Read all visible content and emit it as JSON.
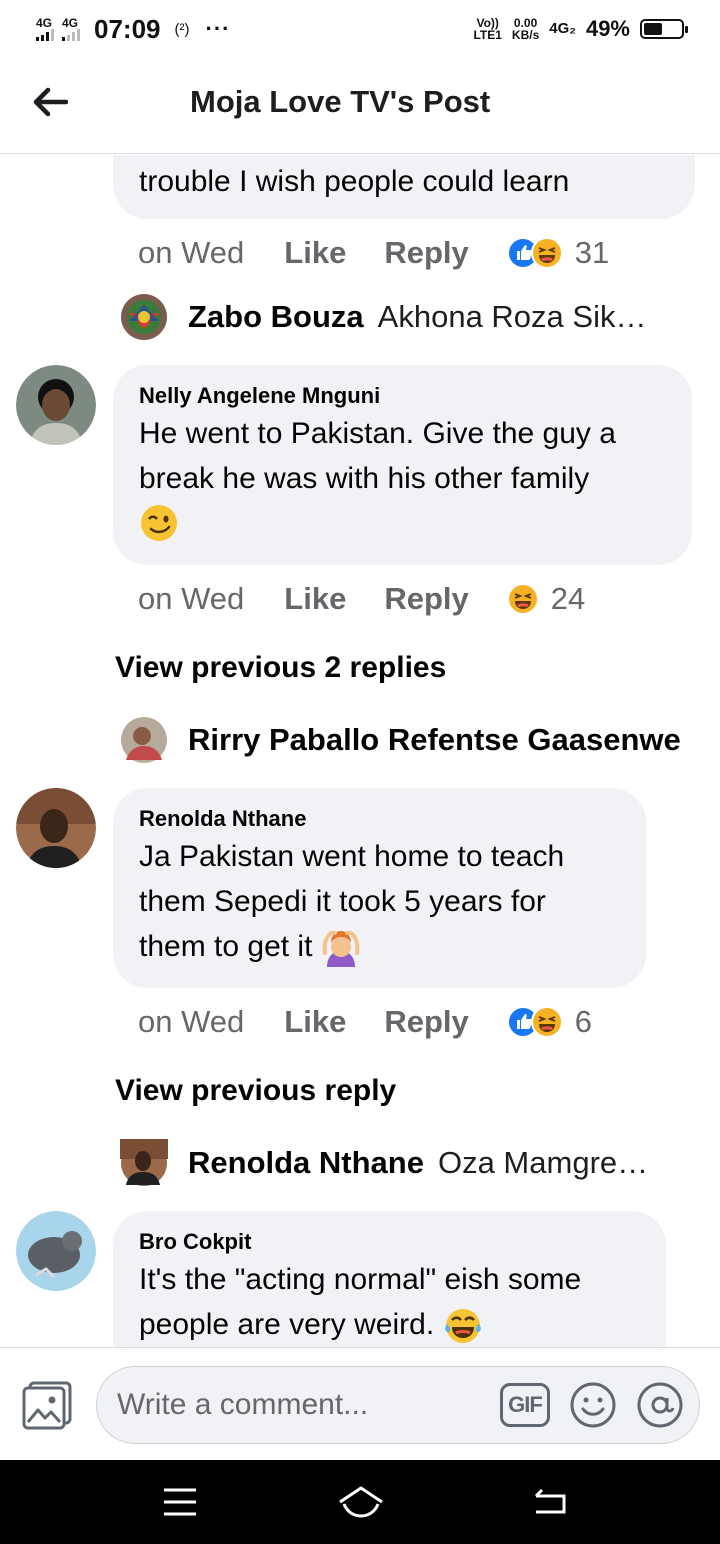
{
  "status_bar": {
    "network1": "4G",
    "network2": "4G",
    "time": "07:09",
    "hotspot": "(²)",
    "more": "···",
    "volte_top": "Vo))",
    "volte_bottom": "LTE1",
    "speed_top": "0.00",
    "speed_bottom": "KB/s",
    "network3": "4G₂",
    "battery": "49%",
    "battery_level": 0.49
  },
  "header": {
    "title": "Moja Love TV's Post",
    "back_icon": "arrow-left-icon"
  },
  "comments": [
    {
      "text": "trouble I wish people could learn",
      "time": "on Wed",
      "like": "Like",
      "reply": "Reply",
      "reactions": [
        "like",
        "haha"
      ],
      "count": "31",
      "reply_preview": {
        "name": "Zabo Bouza",
        "snippet": "Akhona Roza Sik…"
      }
    },
    {
      "author": "Nelly Angelene Mnguni",
      "text": "He went to Pakistan. Give the guy a break he was with his other family",
      "emoji": "😉",
      "time": "on Wed",
      "like": "Like",
      "reply": "Reply",
      "reactions": [
        "haha"
      ],
      "count": "24",
      "view_previous": "View previous 2 replies",
      "reply_preview": {
        "name": "Rirry Paballo Refentse Gaasenwe",
        "snippet": ""
      }
    },
    {
      "author": "Renolda Nthane",
      "text_line1": "Ja Pakistan went home to teach",
      "text_line2": "them Sepedi it took 5 years for",
      "text_line3": "them to get it",
      "emoji": "🙆",
      "time": "on Wed",
      "like": "Like",
      "reply": "Reply",
      "reactions": [
        "like",
        "haha"
      ],
      "count": "6",
      "view_previous": "View previous reply",
      "reply_preview": {
        "name": "Renolda Nthane",
        "snippet": "Oza Mamgre…"
      }
    },
    {
      "author": "Bro Cokpit",
      "text_line1": "It's the \"acting normal\" eish some",
      "text_line2": "people are very weird.",
      "emoji": "😂"
    }
  ],
  "composer": {
    "placeholder": "Write a comment...",
    "gif_label": "GIF",
    "photo_icon": "photo-icon",
    "emoji_icon": "smiley-icon",
    "mention_icon": "at-sign-icon"
  },
  "navbar": {
    "menu_icon": "menu-icon",
    "home_icon": "home-icon",
    "back_icon": "back-icon"
  }
}
